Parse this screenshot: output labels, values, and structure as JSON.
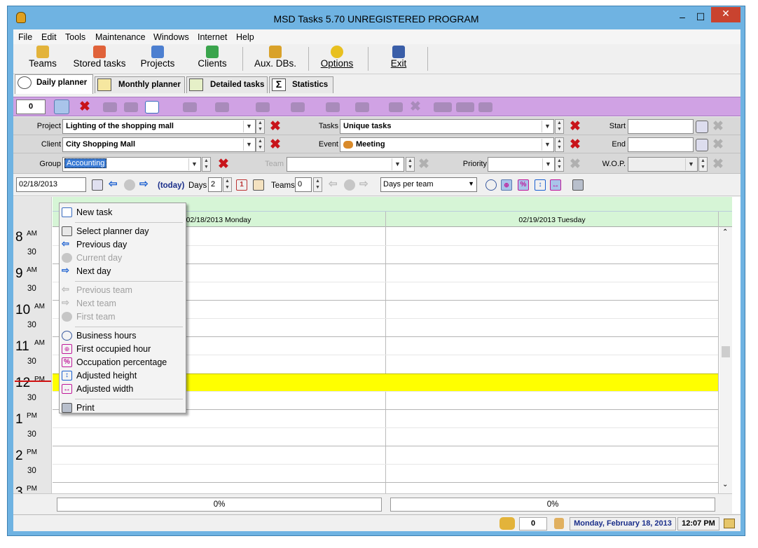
{
  "window": {
    "title": "MSD Tasks 5.70 UNREGISTERED PROGRAM",
    "min": "–",
    "max": "☐",
    "close": "✕"
  },
  "menu": [
    "File",
    "Edit",
    "Tools",
    "Maintenance",
    "Windows",
    "Internet",
    "Help"
  ],
  "toolbar": [
    "Teams",
    "Stored tasks",
    "Projects",
    "Clients",
    "Aux. DBs.",
    "Options",
    "Exit"
  ],
  "tabs": [
    "Daily planner",
    "Monthly planner",
    "Detailed tasks",
    "Statistics"
  ],
  "purple_count": "0",
  "filters": {
    "project_label": "Project",
    "project_value": "Lighting of the shopping mall",
    "tasks_label": "Tasks",
    "tasks_value": "Unique tasks",
    "start_label": "Start",
    "client_label": "Client",
    "client_value": "City Shopping Mall",
    "event_label": "Event",
    "event_value": "Meeting",
    "end_label": "End",
    "group_label": "Group",
    "group_value": "Accounting",
    "team_label": "Team",
    "priority_label": "Priority",
    "wop_label": "W.O.P."
  },
  "nav": {
    "date": "02/18/2013",
    "today": "(today)",
    "days_label": "Days",
    "days": "2",
    "teams_label": "Teams",
    "teams": "0",
    "mode": "Days per team"
  },
  "days": [
    "02/18/2013 Monday",
    "02/19/2013 Tuesday"
  ],
  "hours": [
    {
      "h": "8",
      "p": "AM"
    },
    {
      "h": "9",
      "p": "AM"
    },
    {
      "h": "10",
      "p": "AM"
    },
    {
      "h": "11",
      "p": "AM"
    },
    {
      "h": "12",
      "p": "PM"
    },
    {
      "h": "1",
      "p": "PM"
    },
    {
      "h": "2",
      "p": "PM"
    },
    {
      "h": "3",
      "p": "PM"
    }
  ],
  "half": "30",
  "percent": [
    "0%",
    "0%"
  ],
  "context_menu": {
    "items": [
      "New task",
      "Select planner day",
      "Previous day",
      "Current day",
      "Next day",
      "Previous team",
      "Next team",
      "First team",
      "Business hours",
      "First occupied hour",
      "Occupation percentage",
      "Adjusted height",
      "Adjusted width",
      "Print"
    ]
  },
  "status": {
    "count": "0",
    "date": "Monday, February 18, 2013",
    "time": "12:07 PM"
  },
  "colors": {
    "title_bg": "#6fb3e2",
    "purple_bar": "#d0a2e4",
    "header_green": "#d6f5d6",
    "noon": "#ffff00",
    "date_blue": "#1a2e8a"
  }
}
